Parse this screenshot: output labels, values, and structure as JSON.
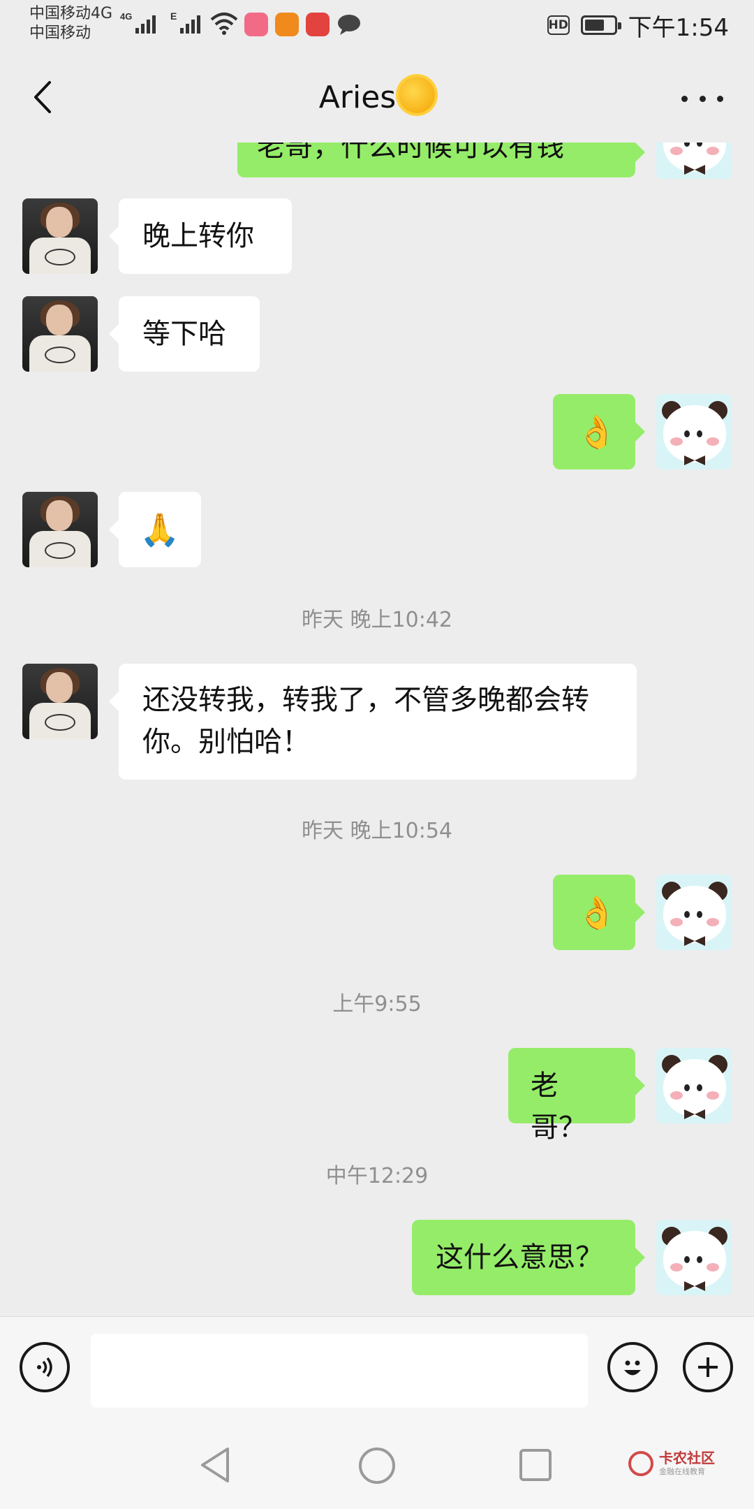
{
  "status_bar": {
    "carrier_line1": "中国移动4G",
    "carrier_line2": "中国移动",
    "time": "下午1:54",
    "hd_badge": "HD",
    "signal_icons": [
      "signal-4g-icon",
      "signal-e-icon",
      "wifi-icon"
    ],
    "app_icons": [
      "pink-app-icon",
      "orange-app-icon",
      "red-book-icon",
      "chat-bubble-icon"
    ]
  },
  "header": {
    "title": "Aries",
    "title_emoji_icon": "sun-face-emoji-icon",
    "back_icon": "back-chevron-icon",
    "more_icon": "more-dots-icon"
  },
  "messages": [
    {
      "side": "out",
      "text": "老哥，什么时候可以有钱"
    },
    {
      "side": "in",
      "text": "晚上转你"
    },
    {
      "side": "in",
      "text": "等下哈"
    },
    {
      "side": "out",
      "text": "👌"
    },
    {
      "side": "in",
      "text": "🙏"
    },
    {
      "type": "time",
      "text": "昨天 晚上10:42"
    },
    {
      "side": "in",
      "text": "还没转我，转我了，不管多晚都会转你。别怕哈！"
    },
    {
      "type": "time",
      "text": "昨天 晚上10:54"
    },
    {
      "side": "out",
      "text": "👌"
    },
    {
      "type": "time",
      "text": "上午9:55"
    },
    {
      "side": "out",
      "text": "老哥？"
    },
    {
      "type": "time",
      "text": "中午12:29"
    },
    {
      "side": "out",
      "text": "这什么意思？"
    }
  ],
  "input_bar": {
    "voice_icon": "voice-icon",
    "emoji_icon": "emoji-smile-icon",
    "plus_icon": "plus-icon"
  },
  "system_nav": {
    "back_icon": "nav-back-triangle-icon",
    "home_icon": "nav-home-circle-icon",
    "recent_icon": "nav-recent-square-icon"
  },
  "watermark": {
    "name": "卡农社区",
    "subtitle": "金融在线教育"
  }
}
